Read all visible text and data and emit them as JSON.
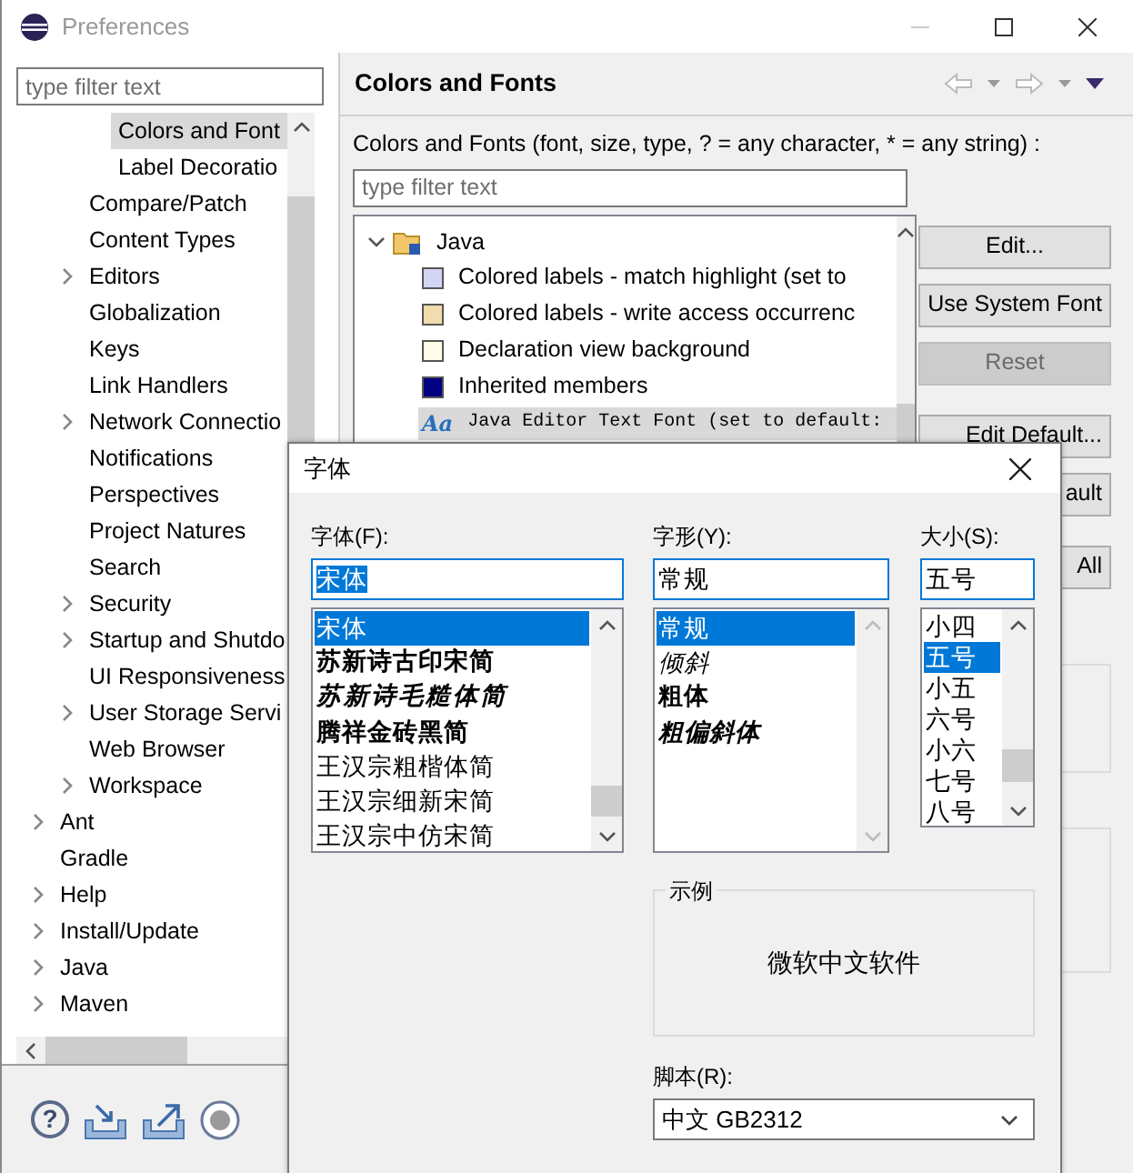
{
  "window": {
    "title": "Preferences"
  },
  "sidebar": {
    "filter": {
      "placeholder": "type filter text"
    },
    "items": [
      {
        "children": [
          {
            "children": [
              {
                "label": "Colors and Font",
                "kind": "leaf",
                "selected": true
              },
              {
                "label": "Label Decoratio",
                "kind": "leaf",
                "selected": false
              }
            ]
          },
          {
            "label": "Compare/Patch",
            "kind": "leaf",
            "selected": false
          },
          {
            "label": "Content Types",
            "kind": "leaf",
            "selected": false
          },
          {
            "label": "Editors",
            "kind": "collapsed",
            "selected": false
          },
          {
            "label": "Globalization",
            "kind": "leaf",
            "selected": false
          },
          {
            "label": "Keys",
            "kind": "leaf",
            "selected": false
          },
          {
            "label": "Link Handlers",
            "kind": "leaf",
            "selected": false
          },
          {
            "label": "Network Connectio",
            "kind": "collapsed",
            "selected": false
          },
          {
            "label": "Notifications",
            "kind": "leaf",
            "selected": false
          },
          {
            "label": "Perspectives",
            "kind": "leaf",
            "selected": false
          },
          {
            "label": "Project Natures",
            "kind": "leaf",
            "selected": false
          },
          {
            "label": "Search",
            "kind": "leaf",
            "selected": false
          },
          {
            "label": "Security",
            "kind": "collapsed",
            "selected": false
          },
          {
            "label": "Startup and Shutdo",
            "kind": "collapsed",
            "selected": false
          },
          {
            "label": "UI Responsiveness",
            "kind": "leaf",
            "selected": false
          },
          {
            "label": "User Storage Servi",
            "kind": "collapsed",
            "selected": false
          },
          {
            "label": "Web Browser",
            "kind": "leaf",
            "selected": false
          },
          {
            "label": "Workspace",
            "kind": "collapsed",
            "selected": false
          }
        ]
      },
      {
        "label": "Ant",
        "kind": "collapsed",
        "selected": false
      },
      {
        "label": "Gradle",
        "kind": "leaf",
        "selected": false
      },
      {
        "label": "Help",
        "kind": "collapsed",
        "selected": false
      },
      {
        "label": "Install/Update",
        "kind": "collapsed",
        "selected": false
      },
      {
        "label": "Java",
        "kind": "collapsed",
        "selected": false
      },
      {
        "label": "Maven",
        "kind": "collapsed",
        "selected": false
      }
    ]
  },
  "bottom_icons": [
    {
      "kind": "help",
      "glyph": "?"
    },
    {
      "kind": "import"
    },
    {
      "kind": "export"
    },
    {
      "kind": "record"
    }
  ],
  "page": {
    "title": "Colors and Fonts",
    "description": "Colors and Fonts (font, size, type, ? = any character, * = any string) :",
    "filter": {
      "placeholder": "type filter text"
    },
    "tree": [
      {
        "label": "Java",
        "kind": "category",
        "selected": false,
        "children": [
          {
            "label": "Colored labels - match highlight (set to",
            "kind": "color",
            "color": "#d4d4f4",
            "selected": false
          },
          {
            "label": "Colored labels - write access occurrenc",
            "kind": "color",
            "color": "#f0dcac",
            "selected": false
          },
          {
            "label": "Declaration view background",
            "kind": "color",
            "color": "#fffde8",
            "selected": false
          },
          {
            "label": "Inherited members",
            "kind": "color",
            "color": "#000080",
            "selected": false
          },
          {
            "label": "Java Editor Text Font (set to default:",
            "kind": "font",
            "glyph": "Aa",
            "selected": true
          }
        ]
      }
    ],
    "button_groups": [
      [
        {
          "label": "Edit...",
          "disabled": false
        },
        {
          "label": "Use System Font",
          "disabled": false
        },
        {
          "label": "Reset",
          "disabled": true
        }
      ],
      [
        {
          "label": "Edit Default...",
          "disabled": false
        },
        {
          "label": "ault",
          "disabled": false
        }
      ],
      [
        {
          "label": "All",
          "disabled": false
        }
      ]
    ]
  },
  "font_dialog": {
    "title": "字体",
    "font": {
      "label": "字体(F):",
      "value": "宋体",
      "options": [
        {
          "label": "宋体",
          "kind": "regular",
          "selected": true
        },
        {
          "label": "苏新诗古印宋简",
          "kind": "bold",
          "selected": false
        },
        {
          "label": "苏新诗毛糙体简",
          "kind": "brush",
          "selected": false
        },
        {
          "label": "腾祥金砖黑简",
          "kind": "heavy",
          "selected": false
        },
        {
          "label": "王汉宗粗楷体简",
          "kind": "regular",
          "selected": false
        },
        {
          "label": "王汉宗细新宋简",
          "kind": "regular",
          "selected": false
        },
        {
          "label": "王汉宗中仿宋简",
          "kind": "regular",
          "selected": false
        }
      ]
    },
    "style": {
      "label": "字形(Y):",
      "value": "常规",
      "options": [
        {
          "label": "常规",
          "kind": "regular",
          "selected": true
        },
        {
          "label": "倾斜",
          "kind": "italic",
          "selected": false
        },
        {
          "label": "粗体",
          "kind": "bold",
          "selected": false
        },
        {
          "label": "粗偏斜体",
          "kind": "bold-italic",
          "selected": false
        }
      ]
    },
    "size": {
      "label": "大小(S):",
      "value": "五号",
      "options": [
        {
          "label": "小四",
          "selected": false
        },
        {
          "label": "五号",
          "selected": true
        },
        {
          "label": "小五",
          "selected": false
        },
        {
          "label": "六号",
          "selected": false
        },
        {
          "label": "小六",
          "selected": false
        },
        {
          "label": "七号",
          "selected": false
        },
        {
          "label": "八号",
          "selected": false
        }
      ]
    },
    "sample": {
      "legend": "示例",
      "text": "微软中文软件"
    },
    "script": {
      "label": "脚本(R):",
      "value": "中文 GB2312"
    }
  }
}
